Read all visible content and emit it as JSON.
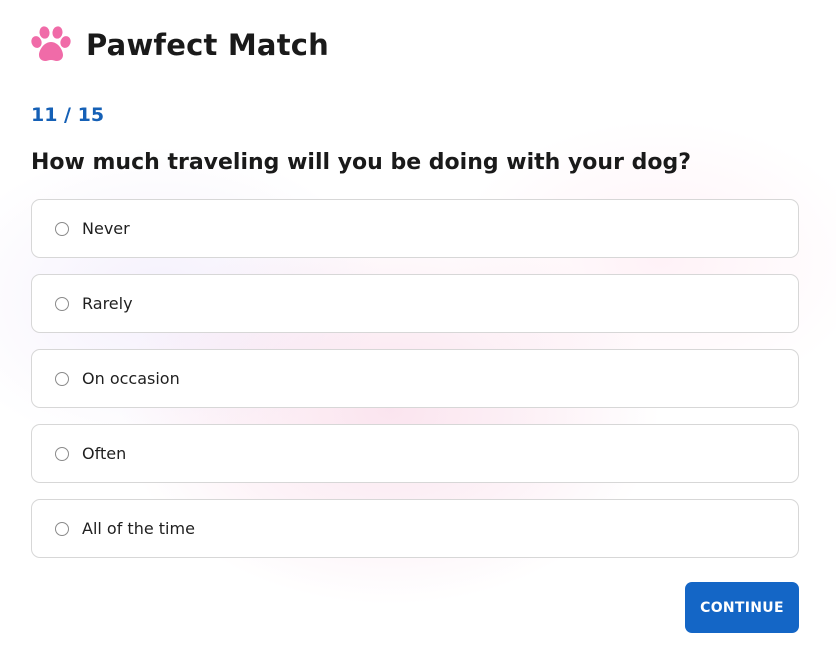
{
  "app": {
    "name": "Pawfect Match",
    "logo_icon": "paw-icon",
    "accent_color": "#f06ba8"
  },
  "quiz": {
    "progress": "11 / 15",
    "question": "How much traveling will you be doing with your dog?",
    "options": [
      {
        "label": "Never",
        "selected": false
      },
      {
        "label": "Rarely",
        "selected": false
      },
      {
        "label": "On occasion",
        "selected": false
      },
      {
        "label": "Often",
        "selected": false
      },
      {
        "label": "All of the time",
        "selected": false
      }
    ]
  },
  "actions": {
    "continue_label": "CONTINUE",
    "button_color": "#1466c6"
  }
}
